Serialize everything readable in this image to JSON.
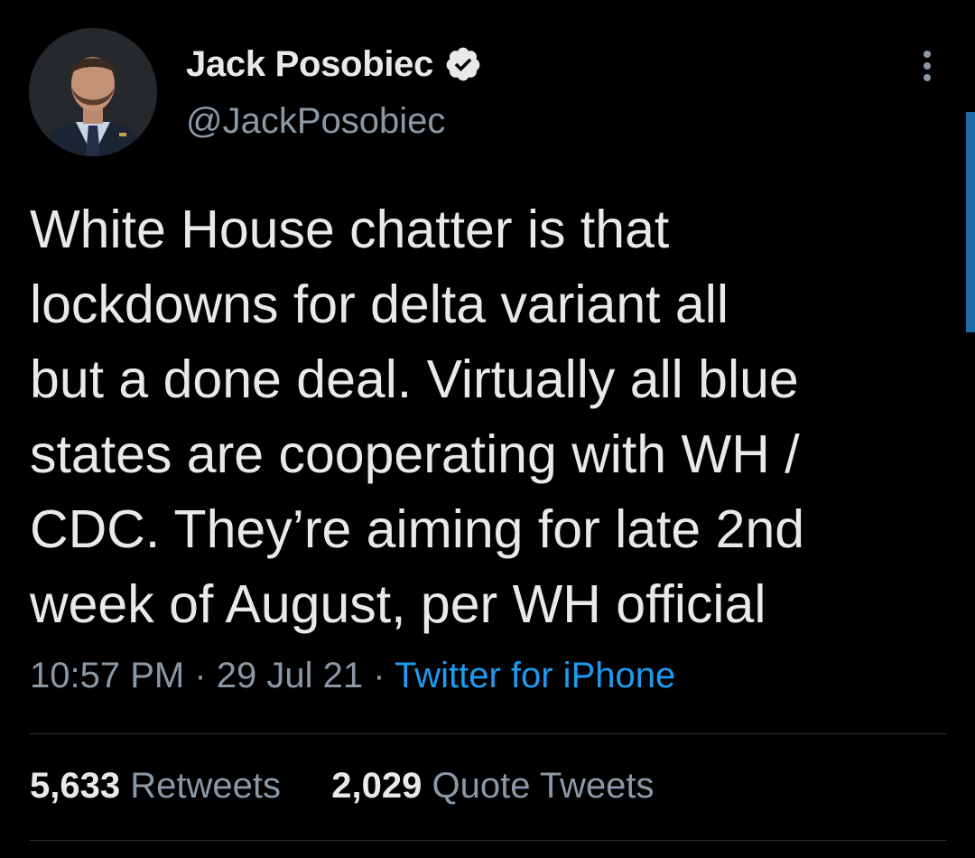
{
  "tweet": {
    "author": {
      "display_name": "Jack Posobiec",
      "handle": "@JackPosobiec",
      "verified": true
    },
    "text": "White House chatter is that\nlockdowns for delta variant all\nbut a done deal. Virtually all blue\nstates are cooperating with WH /\nCDC. They’re aiming for late 2nd\nweek of August, per WH official",
    "time": "10:57 PM",
    "separator": "·",
    "date": "29 Jul 21",
    "source": "Twitter for iPhone"
  },
  "stats": {
    "retweets_count": "5,633",
    "retweets_label": "Retweets",
    "quotes_count": "2,029",
    "quotes_label": "Quote Tweets"
  },
  "icons": {
    "verified": "verified-badge-icon",
    "more": "more-options-icon"
  },
  "colors": {
    "background": "#000000",
    "text": "#e7e9ea",
    "secondary": "#8b98a5",
    "link": "#1d9bf0",
    "divider": "#2f3336"
  }
}
